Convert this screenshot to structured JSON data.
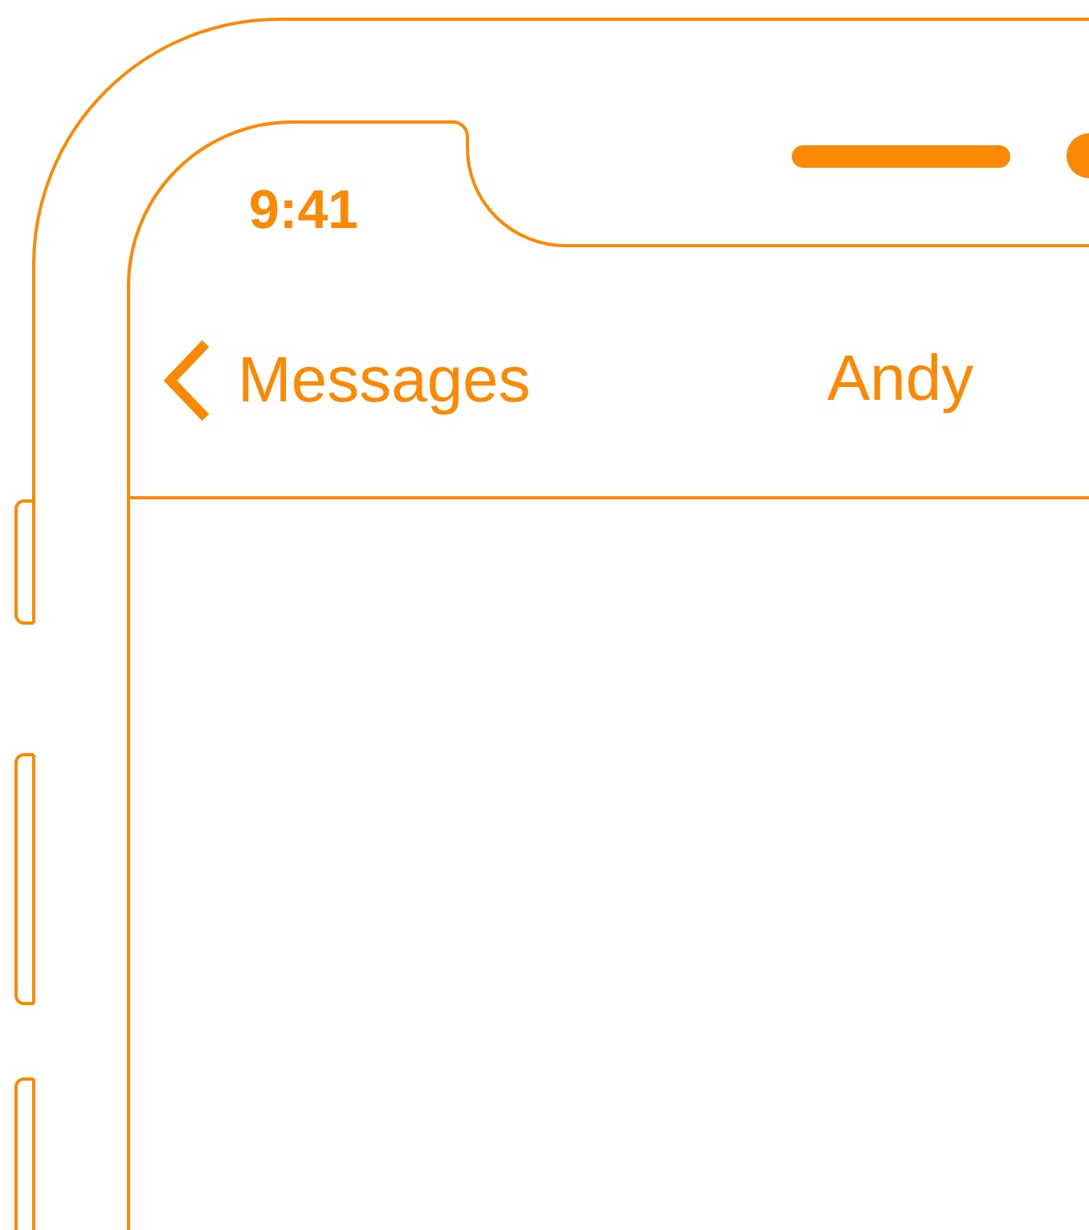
{
  "status_bar": {
    "time": "9:41"
  },
  "nav_bar": {
    "back_label": "Messages",
    "title": "Andy"
  }
}
